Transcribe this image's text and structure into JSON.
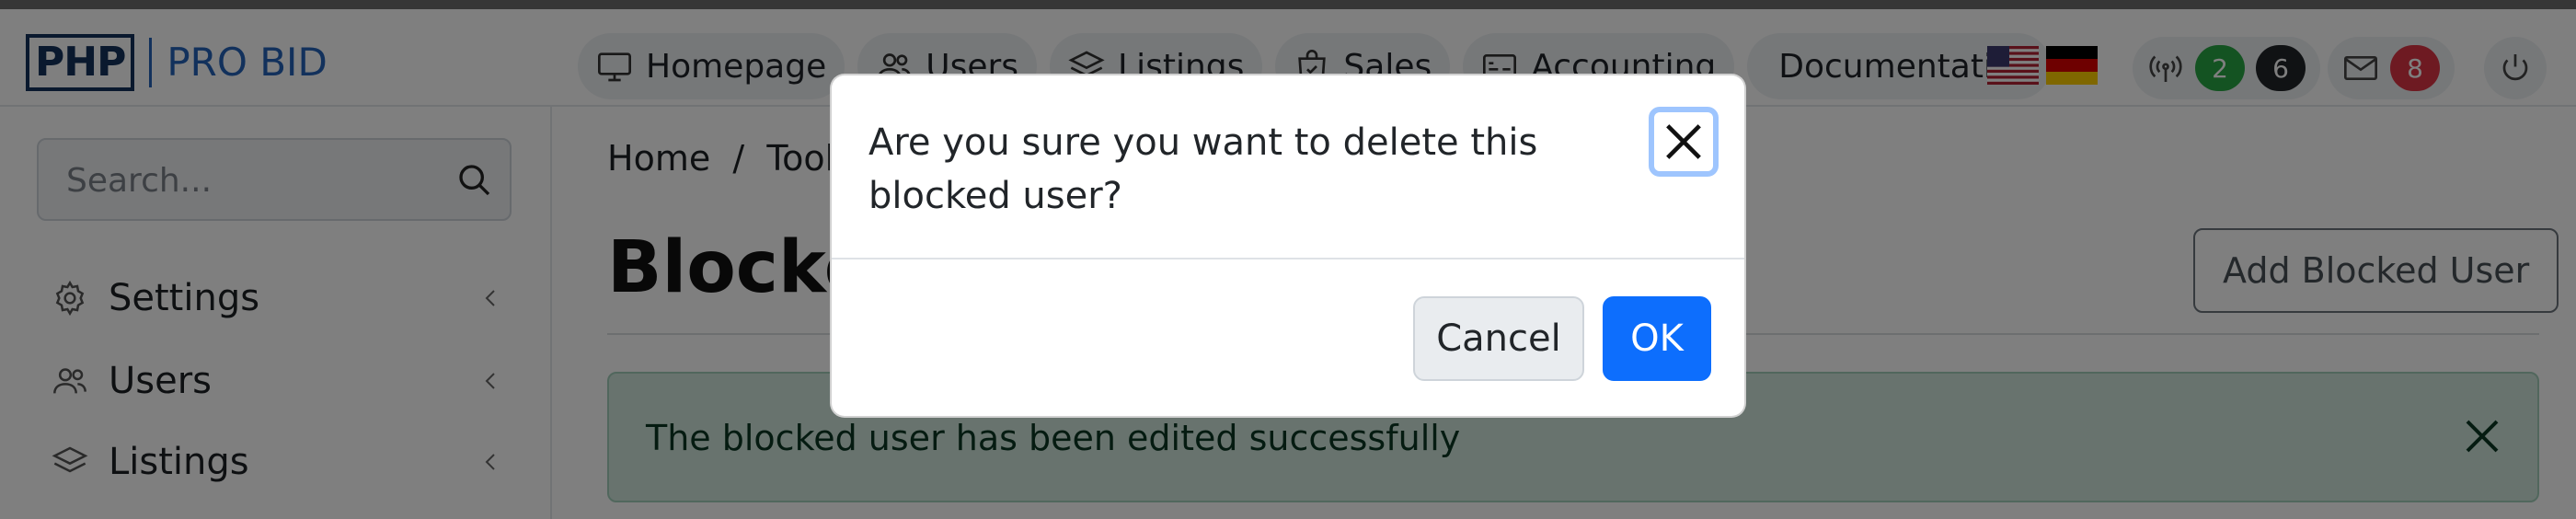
{
  "header": {
    "logo_mark": "PHP",
    "logo_text": "PRO BID",
    "nav": [
      {
        "label": "Homepage",
        "icon": "monitor-icon"
      },
      {
        "label": "Users",
        "icon": "users-icon"
      },
      {
        "label": "Listings",
        "icon": "layers-icon"
      },
      {
        "label": "Sales",
        "icon": "shopping-bag-icon"
      },
      {
        "label": "Accounting",
        "icon": "credit-card-icon"
      },
      {
        "label": "Documentation",
        "icon": "book-icon"
      }
    ],
    "languages": [
      "us-flag-icon",
      "de-flag-icon"
    ],
    "status_badge_green": "2",
    "status_badge_dark": "6",
    "messages_badge": "8"
  },
  "sidebar": {
    "search_placeholder": "Search...",
    "items": [
      {
        "label": "Settings",
        "icon": "gear-icon"
      },
      {
        "label": "Users",
        "icon": "users-icon"
      },
      {
        "label": "Listings",
        "icon": "layers-icon"
      }
    ]
  },
  "main": {
    "breadcrumb": "Home  /  Tools",
    "title": "Blocked",
    "add_button": "Add Blocked User",
    "alert_text": "The blocked user has been edited successfully"
  },
  "modal": {
    "message": "Are you sure you want to delete this blocked user?",
    "cancel_label": "Cancel",
    "ok_label": "OK"
  },
  "colors": {
    "primary": "#0d6efd",
    "badge_green": "#28a745",
    "badge_dark": "#212529",
    "badge_red": "#dc3545",
    "alert_bg": "#d1e7dd",
    "logo_blue": "#2563b8"
  }
}
